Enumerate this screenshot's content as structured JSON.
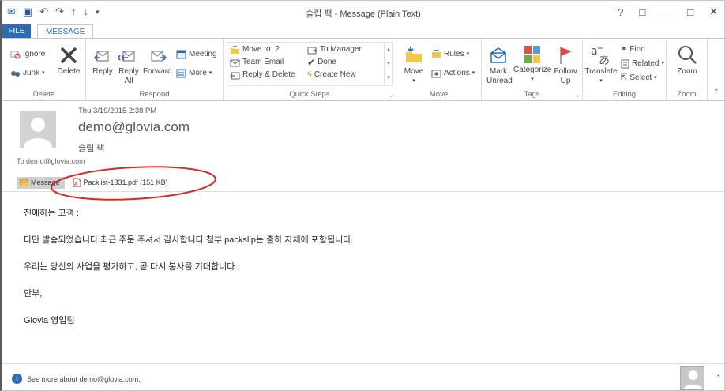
{
  "window": {
    "title": "슬립 팩 - Message (Plain Text)",
    "help": "?",
    "controls": [
      "□",
      "—",
      "□",
      "✕"
    ]
  },
  "tabs": [
    {
      "label": "FILE"
    },
    {
      "label": "MESSAGE"
    }
  ],
  "ribbon": {
    "delete": {
      "ignore": "Ignore",
      "junk": "Junk",
      "delete": "Delete",
      "group": "Delete"
    },
    "respond": {
      "reply": "Reply",
      "reply_all": "Reply All",
      "forward": "Forward",
      "meeting": "Meeting",
      "more": "More",
      "group": "Respond"
    },
    "quick_steps": {
      "items": [
        "Move to: ?",
        "Team Email",
        "Reply & Delete",
        "To Manager",
        "Done",
        "Create New"
      ],
      "group": "Quick Steps"
    },
    "move": {
      "move": "Move",
      "rules": "Rules",
      "actions": "Actions",
      "group": "Move"
    },
    "tags": {
      "mark_unread": "Mark Unread",
      "categorize": "Categorize",
      "follow_up": "Follow Up",
      "group": "Tags"
    },
    "editing": {
      "translate": "Translate",
      "find": "Find",
      "related": "Related",
      "select": "Select",
      "group": "Editing"
    },
    "zoom": {
      "zoom": "Zoom",
      "group": "Zoom"
    }
  },
  "message": {
    "date": "Thu 3/19/2015 2:38 PM",
    "sender": "demo@glovia.com",
    "subject": "슬립 팩",
    "to": "To   demo@glovia.com",
    "attachments": {
      "message_tab": "Message",
      "pdf": "Packlist-1331.pdf (151 KB)"
    },
    "body": [
      "친애하는 고객 :",
      "다만 발송되었습니다 최근 주문 주셔서 감사합니다.첨부 packslip는 출하 자체에 포함됩니다.",
      "우리는 당신의 사업을 평가하고, 곧 다시 봉사를 기대합니다.",
      "안부,",
      "Glovia 영업팀"
    ]
  },
  "people_pane": {
    "info": "See more about demo@glovia.com."
  },
  "colors": {
    "accent": "#2b6cb8",
    "annotation": "#d42a2a",
    "pdf": "#c4312b",
    "flag": "#e0473c"
  }
}
